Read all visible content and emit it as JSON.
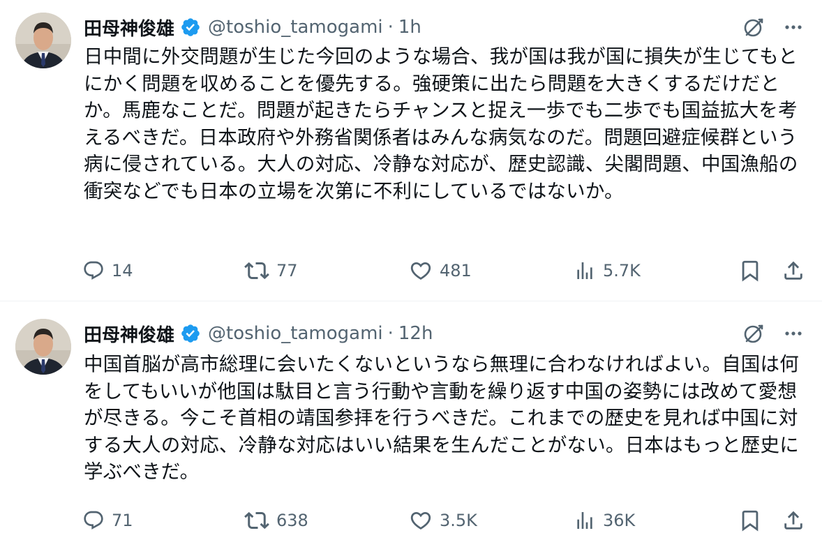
{
  "tweets": [
    {
      "author": {
        "name": "田母神俊雄",
        "handle": "@toshio_tamogami"
      },
      "separator": "·",
      "time": "1h",
      "text": "日中間に外交問題が生じた今回のような場合、我が国は我が国に損失が生じてもとにかく問題を収めることを優先する。強硬策に出たら問題を大きくするだけだとか。馬鹿なことだ。問題が起きたらチャンスと捉え一歩でも二歩でも国益拡大を考えるべきだ。日本政府や外務省関係者はみんな病気なのだ。問題回避症候群という病に侵されている。大人の対応、冷静な対応が、歴史認識、尖閣問題、中国漁船の衝突などでも日本の立場を次第に不利にしているではないか。",
      "stats": {
        "replies": "14",
        "reposts": "77",
        "likes": "481",
        "views": "5.7K"
      }
    },
    {
      "author": {
        "name": "田母神俊雄",
        "handle": "@toshio_tamogami"
      },
      "separator": "·",
      "time": "12h",
      "text": "中国首脳が高市総理に会いたくないというなら無理に合わなければよい。自国は何をしてもいいが他国は駄目と言う行動や言動を繰り返す中国の姿勢には改めて愛想が尽きる。今こそ首相の靖国参拝を行うべきだ。これまでの歴史を見れば中国に対する大人の対応、冷静な対応はいい結果を生んだことがない。日本はもっと歴史に学ぶべきだ。",
      "stats": {
        "replies": "71",
        "reposts": "638",
        "likes": "3.5K",
        "views": "36K"
      }
    }
  ],
  "icons": {
    "verified": "verified-badge-icon",
    "grok": "grok-icon",
    "more": "more-icon",
    "reply": "reply-icon",
    "repost": "repost-icon",
    "like": "like-icon",
    "views": "views-icon",
    "bookmark": "bookmark-icon",
    "share": "share-icon"
  },
  "colors": {
    "accent": "#1d9bf0",
    "text": "#0f1419",
    "secondary": "#536471",
    "divider": "#eff3f4"
  }
}
